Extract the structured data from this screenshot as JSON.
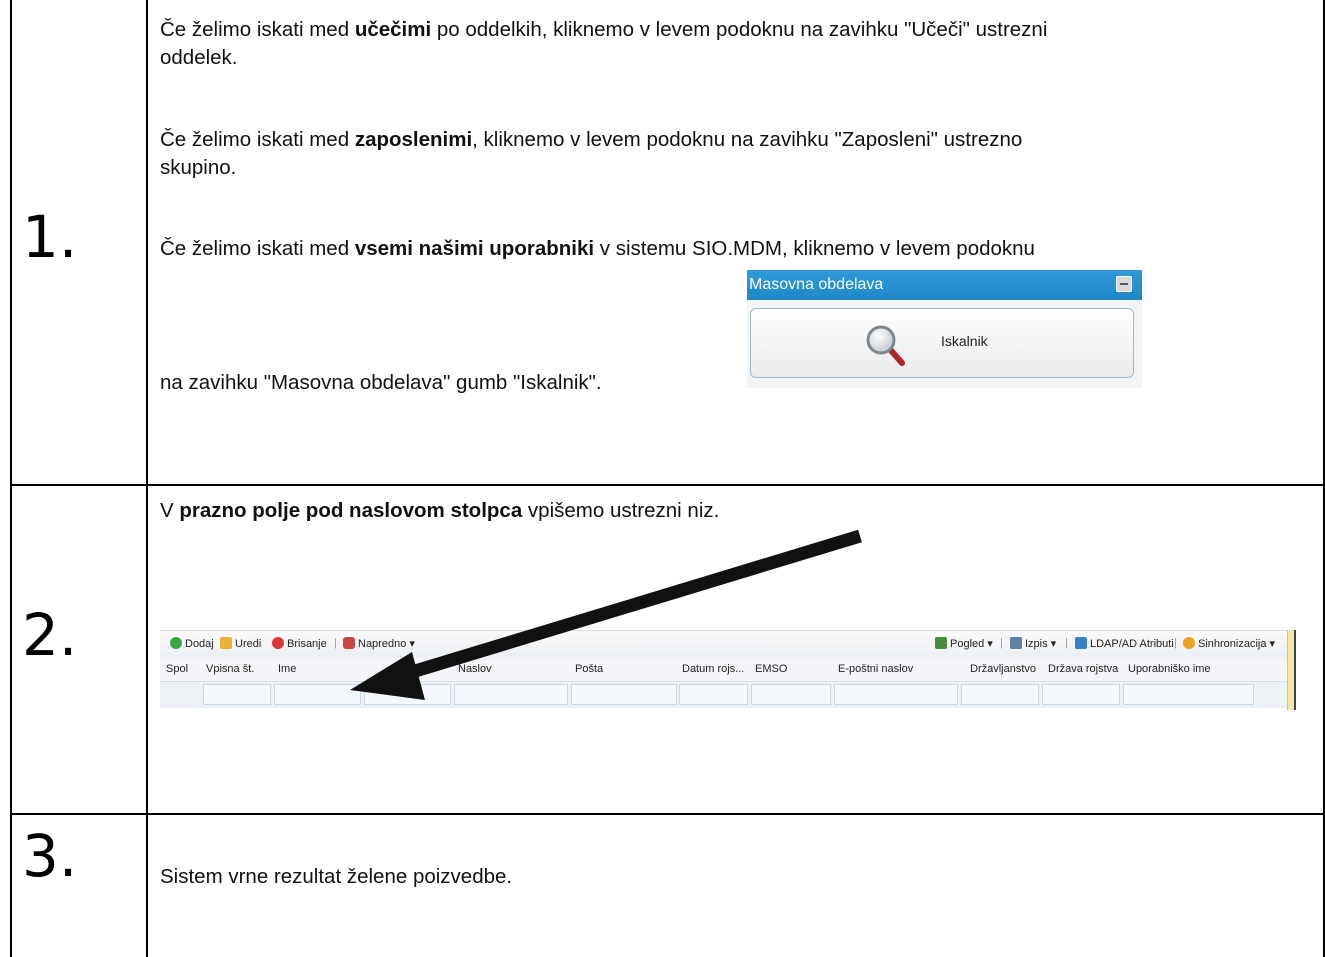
{
  "steps": [
    {
      "number": "1.",
      "paragraphs": {
        "p1": {
          "pre": "Če želimo iskati med ",
          "bold": "učečimi",
          "post_line1": " po oddelkih, kliknemo v levem podoknu na zavihku \"Učeči\" ustrezni",
          "line2": "oddelek."
        },
        "p2": {
          "pre": "Če želimo iskati med ",
          "bold": "zaposlenimi",
          "post_line1": ", kliknemo v levem podoknu na zavihku \"Zaposleni\" ustrezno",
          "line2": "skupino."
        },
        "p3": {
          "pre": "Če želimo iskati med ",
          "bold": "vsemi našimi uporabniki",
          "post_line1": " v sistemu SIO.MDM, kliknemo v levem podoknu",
          "line2": "na zavihku \"Masovna obdelava\" gumb \"Iskalnik\"."
        }
      },
      "masovna_obdelava": {
        "header": "Masovna obdelava",
        "button_label": "Iskalnik"
      }
    },
    {
      "number": "2.",
      "text_pre": "V ",
      "text_bold": "prazno polje pod naslovom stolpca",
      "text_post": " vpišemo ustrezni niz.",
      "toolbar": {
        "left": [
          "Dodaj",
          "Uredi",
          "Brisanje",
          "Napredno ▾"
        ],
        "right": [
          "Pogled ▾",
          "Izpis ▾",
          "LDAP/AD Atributi",
          "Sinhronizacija ▾"
        ]
      },
      "columns": [
        "Spol",
        "Vpisna št.",
        "Ime",
        "Naslov",
        "Pošta",
        "Datum rojs...",
        "EMSO",
        "E-poštni naslov",
        "Državljanstvo",
        "Država rojstva",
        "Uporabniško ime"
      ]
    },
    {
      "number": "3.",
      "text": "Sistem vrne rezultat želene poizvedbe."
    }
  ],
  "colors": {
    "panel_header": "#1f87c8",
    "arrow": "#111111",
    "border": "#000000"
  }
}
